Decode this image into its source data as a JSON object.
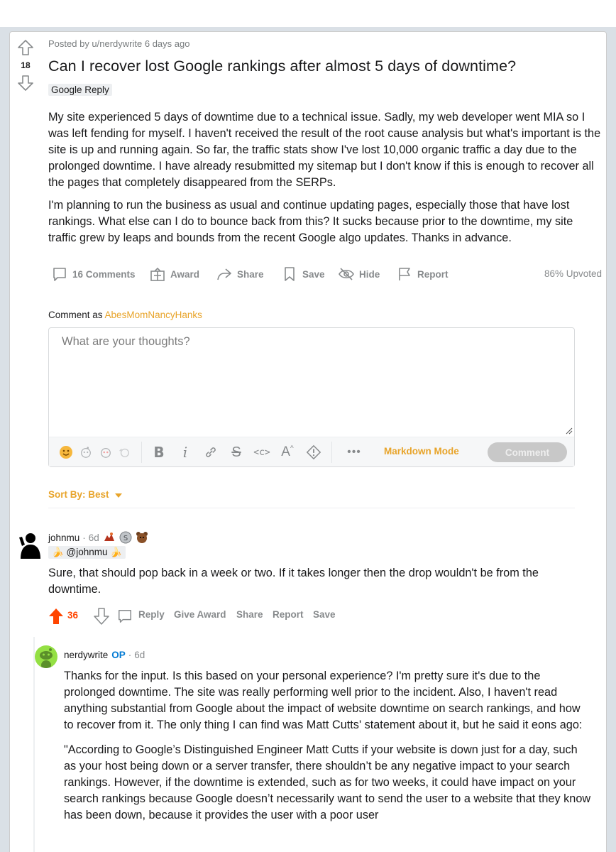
{
  "post": {
    "meta": "Posted by u/nerdywrite 6 days ago",
    "score": "18",
    "title": "Can I recover lost Google rankings after almost 5 days of downtime?",
    "flair": "Google Reply",
    "body": [
      "My site experienced 5 days of downtime due to a technical issue. Sadly, my web developer went MIA so I was left fending for myself. I haven't received the result of the root cause analysis but what's important is the site is up and running again. So far, the traffic stats show I've lost 10,000 organic traffic a day due to the prolonged downtime. I have already resubmitted my sitemap but I don't know if this is enough to recover all the pages that completely disappeared from the SERPs.",
      "I'm planning to run the business as usual and continue updating pages, especially those that have lost rankings. What else can I do to bounce back from this? It sucks because prior to the downtime, my site traffic grew by leaps and bounds from the recent Google algo updates. Thanks in advance."
    ],
    "actions": {
      "comments": "16 Comments",
      "award": "Award",
      "share": "Share",
      "save": "Save",
      "hide": "Hide",
      "report": "Report"
    },
    "upvoted": "86% Upvoted"
  },
  "composer": {
    "comment_as_label": "Comment as",
    "username": "AbesMomNancyHanks",
    "placeholder": "What are your thoughts?",
    "markdown_mode": "Markdown Mode",
    "submit": "Comment"
  },
  "sort": {
    "label": "Sort By: Best"
  },
  "comments": [
    {
      "user": "johnmu",
      "time": "6d",
      "flair": "🍌 @johnmu 🍌",
      "body": "Sure, that should pop back in a week or two. If it takes longer then the drop wouldn't be from the downtime.",
      "score": "36",
      "actions": {
        "reply": "Reply",
        "give_award": "Give Award",
        "share": "Share",
        "report": "Report",
        "save": "Save"
      }
    },
    {
      "user": "nerdywrite",
      "op_badge": "OP",
      "time": "6d",
      "body": [
        "Thanks for the input. Is this based on your personal experience? I'm pretty sure it's due to the prolonged downtime. The site was really performing well prior to the incident. Also, I haven't read anything substantial from Google about the impact of website downtime on search rankings, and how to recover from it. The only thing I can find was Matt Cutts' statement about it, but he said it eons ago:",
        "\"According to Google’s Distinguished Engineer Matt Cutts if your website is down just for a day, such as your host being down or a server transfer, there shouldn’t be any negative impact to your search rankings. However, if the downtime is extended, such as for two weeks, it could have impact on your search rankings because Google doesn’t necessarily want to send the user to a website that they know has been down, because it provides the user with a poor user"
      ]
    }
  ],
  "colors": {
    "accent": "#e8a42a",
    "upvote": "#ff4500",
    "op": "#0079d3",
    "muted": "#878a8c"
  }
}
